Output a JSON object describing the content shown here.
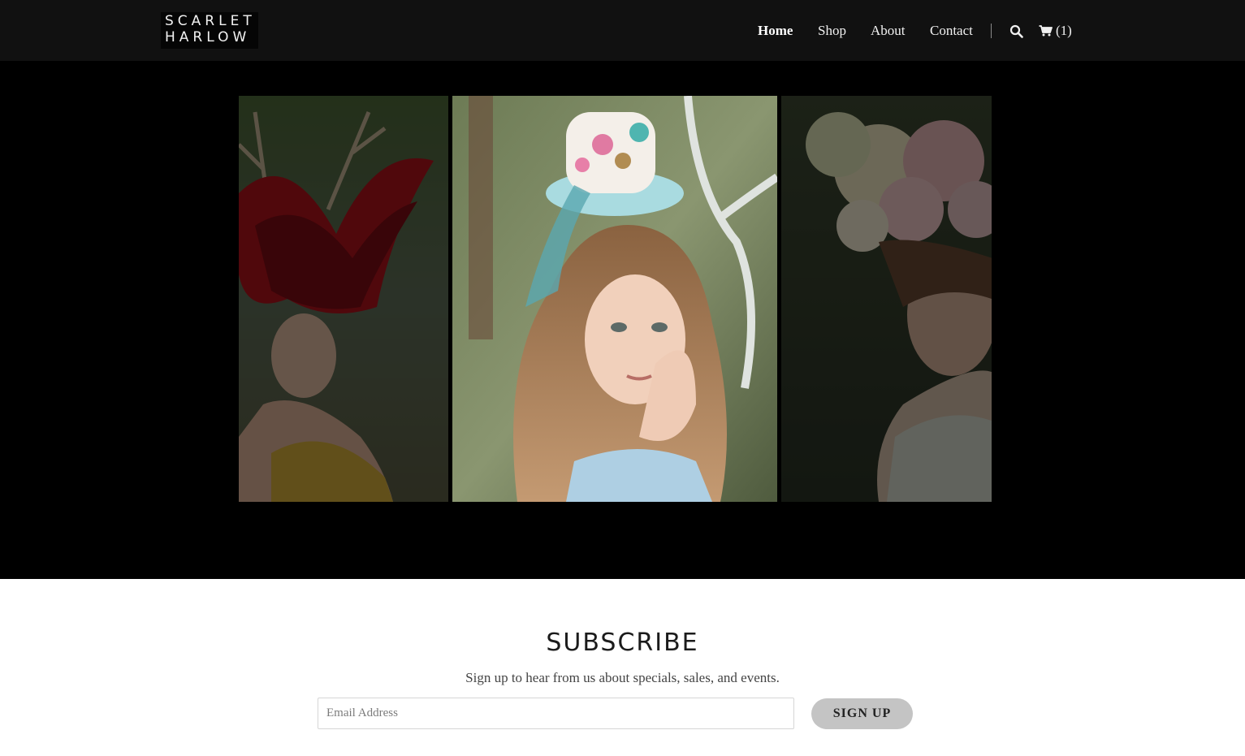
{
  "brand": {
    "line1": "SCARLET",
    "line2": "HARLOW"
  },
  "nav": {
    "items": [
      "Home",
      "Shop",
      "About",
      "Contact"
    ],
    "active": "Home",
    "cart_count": "(1)"
  },
  "hero": {
    "slides": [
      {
        "alt": "Model with red feathered antler headpiece"
      },
      {
        "alt": "Model with floral mini top hat headpiece"
      },
      {
        "alt": "Model with pink and cream flower crown"
      }
    ]
  },
  "subscribe": {
    "title": "SUBSCRIBE",
    "subtitle": "Sign up to hear from us about specials, sales, and events.",
    "email_placeholder": "Email Address",
    "button": "SIGN UP"
  },
  "icons": {
    "search": "search-icon",
    "cart": "cart-icon"
  },
  "colors": {
    "header_bg": "#111111",
    "hero_bg": "#000000",
    "button_bg": "#c4c4c4"
  }
}
